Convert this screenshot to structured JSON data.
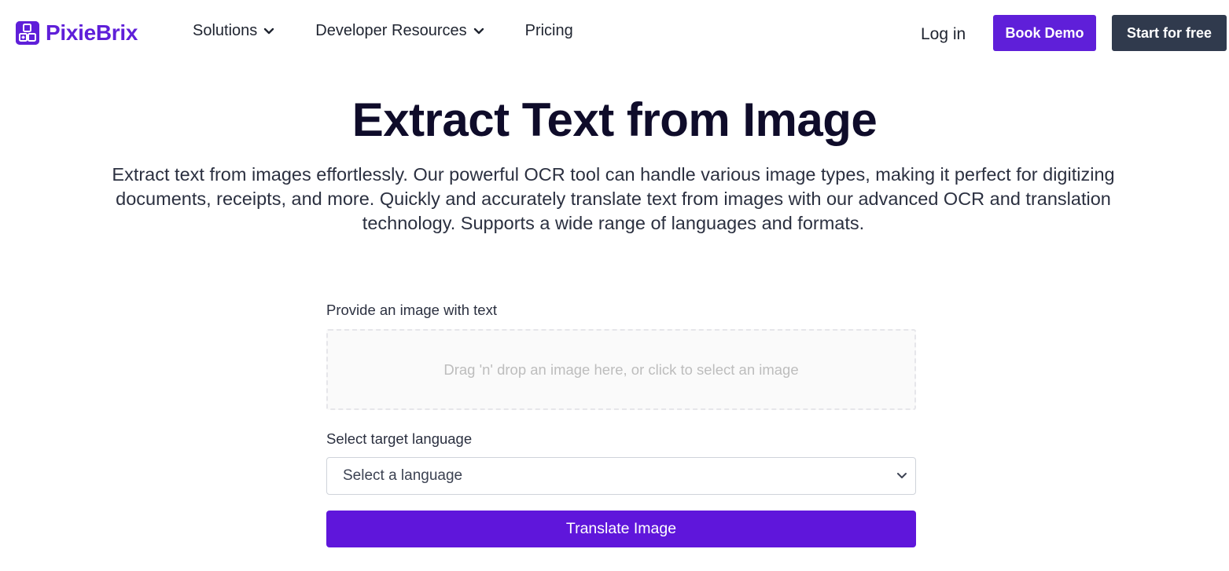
{
  "header": {
    "logo_text": "PixieBrix",
    "logo_icon": "pixiebrix-logo-icon",
    "nav": [
      {
        "label": "Solutions",
        "has_dropdown": true
      },
      {
        "label": "Developer Resources",
        "has_dropdown": true
      },
      {
        "label": "Pricing",
        "has_dropdown": false
      }
    ],
    "login_label": "Log in",
    "book_demo_label": "Book Demo",
    "start_free_label": "Start for free"
  },
  "hero": {
    "title": "Extract Text from Image",
    "description": "Extract text from images effortlessly. Our powerful OCR tool can handle various image types, making it perfect for digitizing documents, receipts, and more. Quickly and accurately translate text from images with our advanced OCR and translation technology. Supports a wide range of languages and formats."
  },
  "form": {
    "image_label": "Provide an image with text",
    "dropzone_text": "Drag 'n' drop an image here, or click to select an image",
    "language_label": "Select target language",
    "language_selected": "Select a language",
    "submit_label": "Translate Image"
  },
  "colors": {
    "brand": "#5f1fd9",
    "dark_button": "#303a4d",
    "title": "#0f0c2a"
  }
}
